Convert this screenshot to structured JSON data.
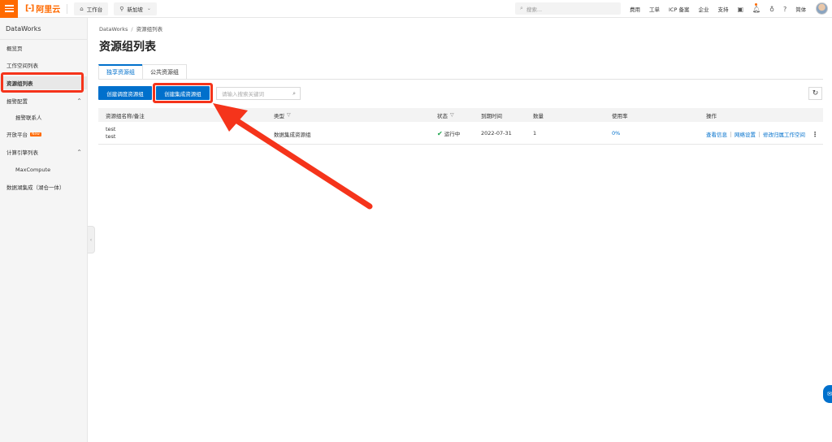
{
  "header": {
    "logo_text": "阿里云",
    "workbench_label": "工作台",
    "region_label": "新加坡",
    "search_placeholder": "搜索...",
    "links": [
      "费用",
      "工单",
      "ICP 备案",
      "企业",
      "支持"
    ],
    "lang_label": "简体"
  },
  "sidebar": {
    "title": "DataWorks",
    "items": [
      {
        "label": "概览页"
      },
      {
        "label": "工作空间列表"
      },
      {
        "label": "资源组列表"
      },
      {
        "label": "报警配置"
      },
      {
        "label": "报警联系人"
      },
      {
        "label": "开放平台"
      },
      {
        "label": "计算引擎列表"
      },
      {
        "label": "MaxCompute"
      },
      {
        "label": "数据湖集成（湖仓一体）"
      }
    ],
    "new_badge": "New"
  },
  "main": {
    "breadcrumb": [
      "DataWorks",
      "资源组列表"
    ],
    "breadcrumb_sep": "/",
    "title": "资源组列表",
    "tabs": [
      {
        "label": "独享资源组"
      },
      {
        "label": "公共资源组"
      }
    ],
    "buttons": {
      "create_schedule": "创建调度资源组",
      "create_integration": "创建集成资源组"
    },
    "search_placeholder": "请输入搜索关键词",
    "table": {
      "columns": [
        "资源组名称/备注",
        "类型",
        "状态",
        "到期时间",
        "数量",
        "使用率",
        "操作"
      ],
      "rows": [
        {
          "name": "test",
          "note": "test",
          "type": "数据集成资源组",
          "status": "运行中",
          "expire": "2022-07-31",
          "count": "1",
          "usage": "0%",
          "ops": [
            "查看信息",
            "网络设置",
            "修改归属工作空间"
          ]
        }
      ]
    }
  },
  "colors": {
    "accent": "#0070cc",
    "brand": "#ff6a00",
    "highlight": "#f5341b",
    "status_ok": "#1aa34a"
  }
}
